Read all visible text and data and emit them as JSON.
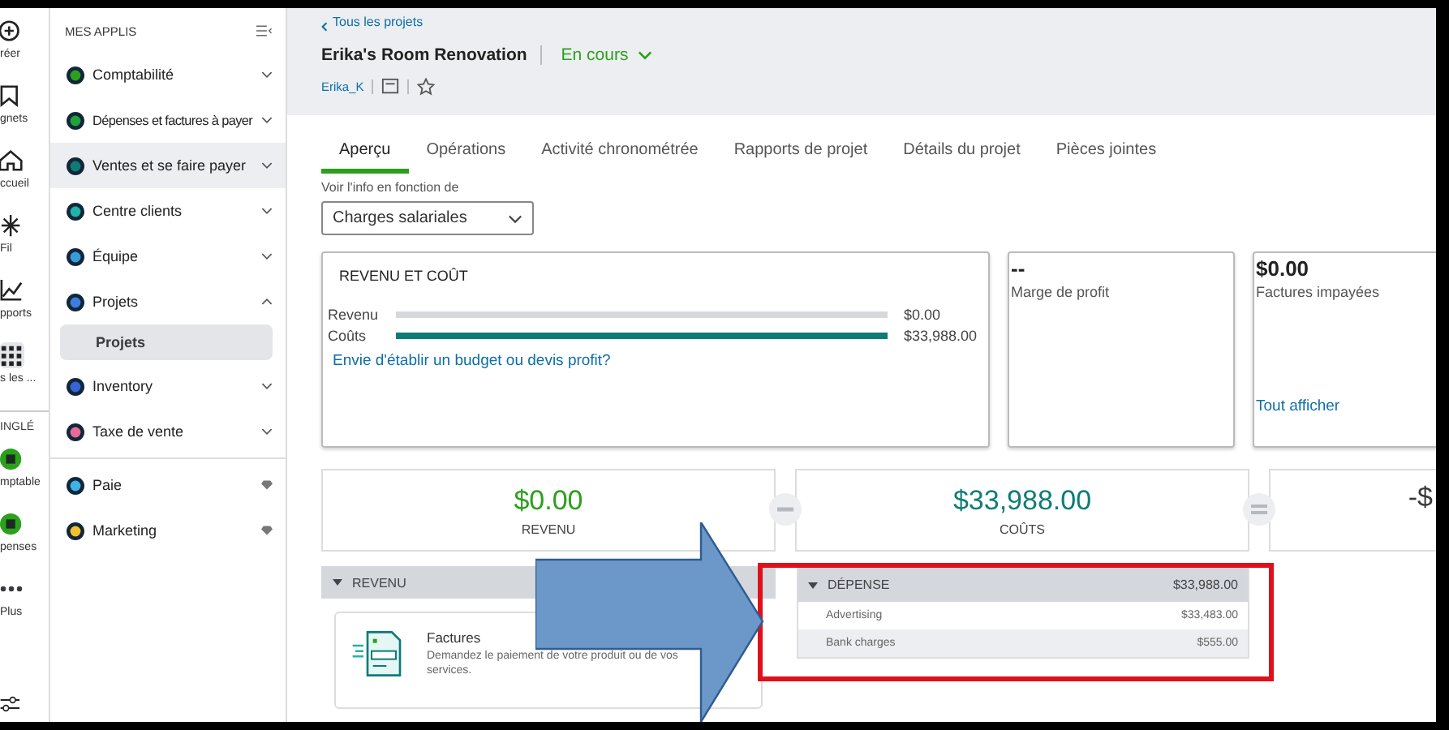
{
  "rail": [
    {
      "label": "réer",
      "selected": false
    },
    {
      "label": "gnets",
      "selected": false
    },
    {
      "label": "ccueil",
      "selected": false
    },
    {
      "label": "Fil",
      "selected": false
    },
    {
      "label": "pports",
      "selected": false
    },
    {
      "label": "s les ...",
      "selected": true
    }
  ],
  "rail_section": "INGLÉ",
  "rail_apps": [
    {
      "kind": "app",
      "label": "mptable",
      "color": "#2ca01c"
    },
    {
      "kind": "app",
      "label": "penses",
      "color": "#2ca01c"
    },
    {
      "kind": "more",
      "label": "Plus",
      "color": "#393a3d"
    }
  ],
  "sidebar": {
    "title": "MES APPLIS",
    "items": [
      {
        "label": "Comptabilité",
        "color": "#2ca01c",
        "kind": "menu",
        "expanded": false,
        "highlighted": false
      },
      {
        "label": "Dépenses et factures à payer",
        "color": "#21a33a",
        "kind": "menu",
        "expanded": false,
        "highlighted": false
      },
      {
        "label": "Ventes et se faire payer",
        "color": "#0d7c77",
        "kind": "menu",
        "expanded": false,
        "highlighted": true
      },
      {
        "label": "Centre clients",
        "color": "#1fb4a7",
        "kind": "menu",
        "expanded": false,
        "highlighted": false
      },
      {
        "label": "Équipe",
        "color": "#3a9bd9",
        "kind": "menu",
        "expanded": false,
        "highlighted": false
      },
      {
        "label": "Projets",
        "color": "#3d7de0",
        "kind": "menu",
        "expanded": true,
        "highlighted": false,
        "children": [
          {
            "label": "Projets",
            "selected": true
          }
        ]
      },
      {
        "label": "Inventory",
        "color": "#3565d6",
        "kind": "menu",
        "expanded": false,
        "highlighted": false
      },
      {
        "label": "Taxe de vente",
        "color": "#e86a9a",
        "kind": "menu",
        "expanded": false,
        "highlighted": false
      },
      {
        "label": "Paie",
        "color": "#3cb4e6",
        "kind": "premium",
        "highlighted": false
      },
      {
        "label": "Marketing",
        "color": "#f2c12e",
        "kind": "premium",
        "highlighted": false
      }
    ]
  },
  "header": {
    "back": "Tous les projets",
    "title": "Erika's Room Renovation",
    "status": "En cours",
    "user": "Erika_K"
  },
  "tabs": [
    {
      "label": "Aperçu",
      "selected": true
    },
    {
      "label": "Opérations",
      "selected": false
    },
    {
      "label": "Activité chronométrée",
      "selected": false
    },
    {
      "label": "Rapports de projet",
      "selected": false
    },
    {
      "label": "Détails du projet",
      "selected": false
    },
    {
      "label": "Pièces jointes",
      "selected": false
    }
  ],
  "view_by": {
    "label": "Voir l'info en fonction de",
    "value": "Charges salariales"
  },
  "income_cost": {
    "title": "REVENU ET COÛT",
    "bars": [
      {
        "label": "Revenu",
        "level": 0,
        "amount": "$0.00"
      },
      {
        "label": "Coûts",
        "level": 1,
        "amount": "$33,988.00"
      }
    ],
    "link": "Envie d'établir un budget ou devis profit?"
  },
  "profit_margin": {
    "value": "--",
    "label": "Marge de profit"
  },
  "unpaid": {
    "value": "$0.00",
    "label": "Factures impayées",
    "link": "Tout afficher"
  },
  "summary": [
    {
      "amount": "$0.00",
      "label": "REVENU",
      "color": "#2ca01c"
    },
    {
      "amount": "$33,988.00",
      "label": "COÛTS",
      "color": "#0d7c77"
    },
    {
      "amount": "-$",
      "color": "#393a3d"
    }
  ],
  "revenue_section": {
    "title": "REVENU",
    "card": {
      "title": "Factures",
      "text": "Demandez le paiement de votre produit ou de vos services."
    }
  },
  "expense_section": {
    "title": "DÉPENSE",
    "total": "$33,988.00",
    "rows": [
      {
        "name": "Advertising",
        "amount": "$33,483.00"
      },
      {
        "name": "Bank charges",
        "amount": "$555.00"
      }
    ]
  }
}
